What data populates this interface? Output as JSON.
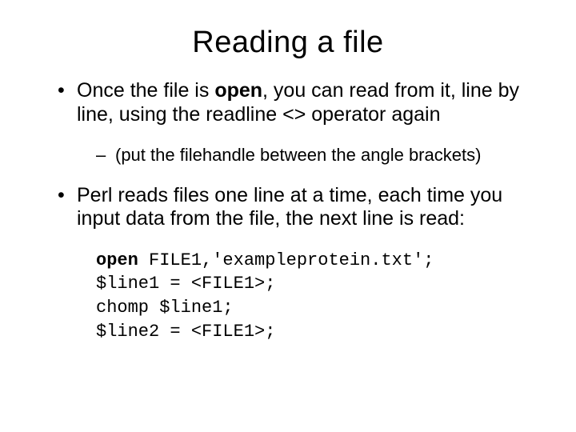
{
  "title": "Reading a file",
  "bullets": {
    "b1_pre": "Once the file is ",
    "b1_bold": "open",
    "b1_post": ", you can read from it, line by line, using the readline <> operator again",
    "b1_sub": "(put the filehandle between the angle brackets)",
    "b2": "Perl reads files one line at a time, each time you input data from the file, the next line is read:"
  },
  "code": {
    "l1_kw": "open",
    "l1_rest": " FILE1,'exampleprotein.txt';",
    "l2": "$line1 = <FILE1>;",
    "l3": "chomp $line1;",
    "l4": "$line2 = <FILE1>;"
  }
}
